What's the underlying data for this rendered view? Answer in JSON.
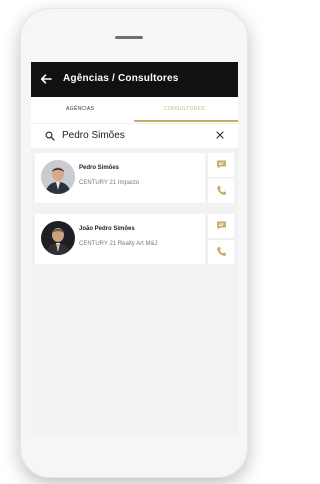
{
  "header": {
    "title": "Agências / Consultores",
    "back_icon": "arrow-left-icon"
  },
  "tabs": [
    {
      "label": "AGÊNCIAS",
      "active": false
    },
    {
      "label": "CONSULTORES",
      "active": true
    }
  ],
  "search": {
    "value": "Pedro Simões",
    "icon": "search-icon",
    "clear_icon": "close-icon"
  },
  "results": [
    {
      "name": "Pedro Simões",
      "agency": "CENTURY 21 Impacto"
    },
    {
      "name": "João Pedro Simões",
      "agency": "CENTURY 21 Realty Art M&J"
    }
  ],
  "colors": {
    "app_bar": "#111111",
    "accent_gold": "#c8ab64",
    "screen_bg": "#f1f1f1"
  }
}
